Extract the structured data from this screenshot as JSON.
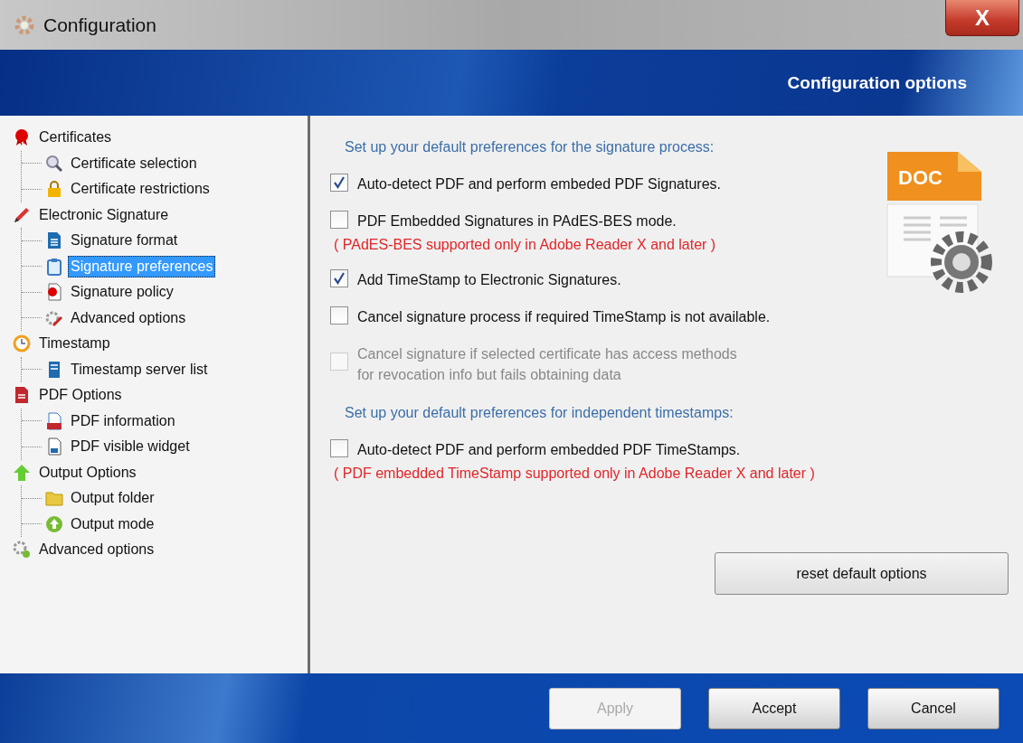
{
  "window": {
    "title": "Configuration",
    "close": "X"
  },
  "banner": {
    "title": "Configuration options"
  },
  "tree": [
    {
      "label": "Certificates",
      "selected": false,
      "children": [
        {
          "label": "Certificate selection",
          "selected": false
        },
        {
          "label": "Certificate restrictions",
          "selected": false
        }
      ]
    },
    {
      "label": "Electronic Signature",
      "selected": false,
      "children": [
        {
          "label": "Signature format",
          "selected": false
        },
        {
          "label": "Signature preferences",
          "selected": true
        },
        {
          "label": "Signature policy",
          "selected": false
        },
        {
          "label": "Advanced options",
          "selected": false
        }
      ]
    },
    {
      "label": "Timestamp",
      "selected": false,
      "children": [
        {
          "label": "Timestamp server list",
          "selected": false
        }
      ]
    },
    {
      "label": "PDF Options",
      "selected": false,
      "children": [
        {
          "label": "PDF information",
          "selected": false
        },
        {
          "label": "PDF visible widget",
          "selected": false
        }
      ]
    },
    {
      "label": "Output Options",
      "selected": false,
      "children": [
        {
          "label": "Output folder",
          "selected": false
        },
        {
          "label": "Output mode",
          "selected": false
        }
      ]
    },
    {
      "label": "Advanced options",
      "selected": false
    }
  ],
  "doc_icon_label": "DOC",
  "sections": [
    {
      "heading": "Set up your default preferences for the signature process:",
      "options": [
        {
          "label": "Auto-detect PDF and perform embeded PDF Signatures.",
          "checked": true,
          "disabled": false
        },
        {
          "label": "PDF Embedded Signatures in PAdES-BES mode.",
          "checked": false,
          "disabled": false,
          "note": "( PAdES-BES supported only in Adobe Reader X and later )"
        },
        {
          "label": "Add TimeStamp to Electronic Signatures.",
          "checked": true,
          "disabled": false
        },
        {
          "label": "Cancel signature process if required TimeStamp is not available.",
          "checked": false,
          "disabled": false
        },
        {
          "label": "Cancel signature if selected certificate has access methods\nfor revocation info but fails obtaining data",
          "checked": false,
          "disabled": true
        }
      ]
    },
    {
      "heading": "Set up your default preferences for independent timestamps:",
      "options": [
        {
          "label": "Auto-detect PDF and perform embedded PDF TimeStamps.",
          "checked": false,
          "disabled": false,
          "note": "( PDF embedded TimeStamp supported only in Adobe Reader X and later )"
        }
      ]
    }
  ],
  "reset_button": {
    "label": "reset default options"
  },
  "buttons": [
    {
      "label": "Apply",
      "disabled": true
    },
    {
      "label": "Accept",
      "disabled": false
    },
    {
      "label": "Cancel",
      "disabled": false
    }
  ]
}
